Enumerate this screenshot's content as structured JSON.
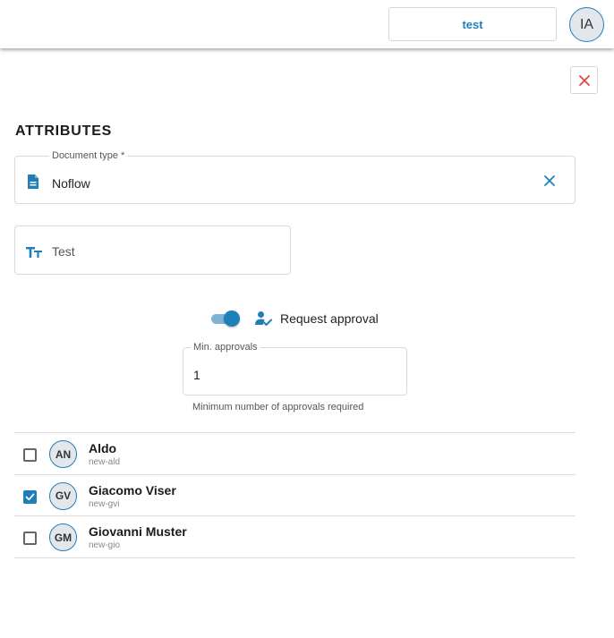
{
  "header": {
    "test_button_label": "test",
    "user_initials": "IA"
  },
  "panel": {
    "section_title": "ATTRIBUTES",
    "document_type": {
      "label": "Document type *",
      "value": "Noflow"
    },
    "title_field": {
      "value": "Test"
    },
    "request_approval": {
      "label": "Request approval",
      "enabled": true
    },
    "min_approvals": {
      "label": "Min. approvals",
      "value": "1",
      "helper": "Minimum number of approvals required"
    },
    "users": [
      {
        "initials": "AN",
        "name": "Aldo",
        "login": "new-ald",
        "checked": false
      },
      {
        "initials": "GV",
        "name": "Giacomo Viser",
        "login": "new-gvi",
        "checked": true
      },
      {
        "initials": "GM",
        "name": "Giovanni Muster",
        "login": "new-gio",
        "checked": false
      }
    ]
  },
  "colors": {
    "accent": "#1f7fb8",
    "close": "#e04848"
  },
  "icons": {
    "close": "close-icon",
    "document": "document-icon",
    "clear": "clear-icon",
    "text_type": "text-type-icon",
    "approval": "user-check-icon"
  }
}
